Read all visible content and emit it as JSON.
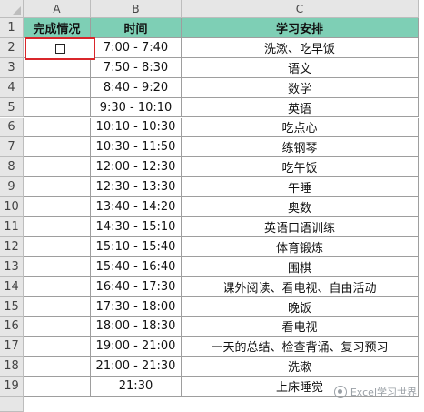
{
  "sheet": {
    "columns": [
      "A",
      "B",
      "C"
    ],
    "row_numbers": [
      "1",
      "2",
      "3",
      "4",
      "5",
      "6",
      "7",
      "8",
      "9",
      "10",
      "11",
      "12",
      "13",
      "14",
      "15",
      "16",
      "17",
      "18",
      "19"
    ],
    "header_bg": "#7ecfb5",
    "selection_color": "#d9262b",
    "header_row": {
      "a": "完成情况",
      "b": "时间",
      "c": "学习安排"
    },
    "rows": [
      {
        "time": "7:00 - 7:40",
        "task": "洗漱、吃早饭"
      },
      {
        "time": "7:50 - 8:30",
        "task": "语文"
      },
      {
        "time": "8:40 - 9:20",
        "task": "数学"
      },
      {
        "time": "9:30 - 10:10",
        "task": "英语"
      },
      {
        "time": "10:10 - 10:30",
        "task": "吃点心"
      },
      {
        "time": "10:30 - 11:50",
        "task": "练钢琴"
      },
      {
        "time": "12:00 - 12:30",
        "task": "吃午饭"
      },
      {
        "time": "12:30 - 13:30",
        "task": "午睡"
      },
      {
        "time": "13:40 - 14:20",
        "task": "奥数"
      },
      {
        "time": "14:30 - 15:10",
        "task": "英语口语训练"
      },
      {
        "time": "15:10 - 15:40",
        "task": "体育锻炼"
      },
      {
        "time": "15:40 - 16:40",
        "task": "围棋"
      },
      {
        "time": "16:40 - 17:30",
        "task": "课外阅读、看电视、自由活动"
      },
      {
        "time": "17:30 - 18:00",
        "task": "晚饭"
      },
      {
        "time": "18:00 - 18:30",
        "task": "看电视"
      },
      {
        "time": "19:00 - 21:00",
        "task": "一天的总结、检查背诵、复习预习"
      },
      {
        "time": "21:00 - 21:30",
        "task": "洗漱"
      },
      {
        "time": "21:30",
        "task": "上床睡觉"
      }
    ]
  },
  "watermark": {
    "text": "Excel学习世界",
    "icon": "wechat-account-icon"
  }
}
